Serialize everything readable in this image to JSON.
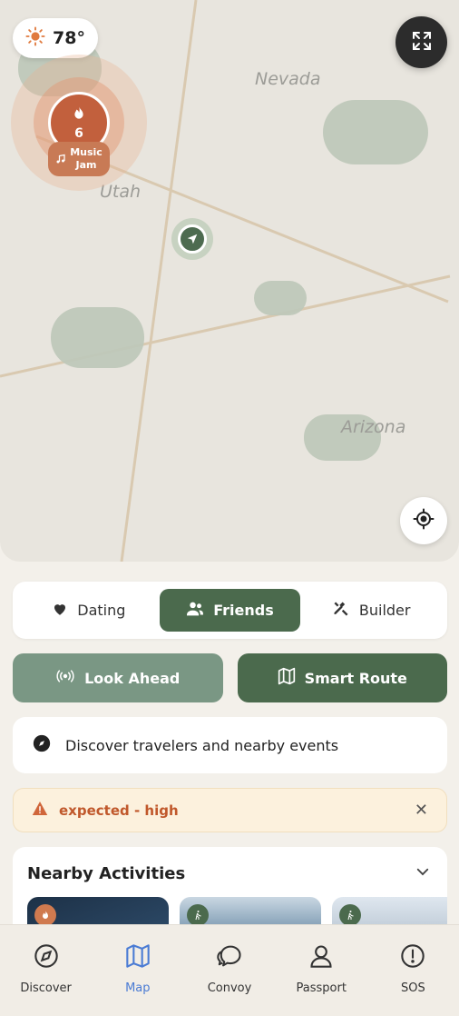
{
  "map": {
    "weather": {
      "icon": "sun-icon",
      "temp": "78°"
    },
    "state_labels": {
      "nevada": "Nevada",
      "utah": "Utah",
      "arizona": "Arizona"
    },
    "event": {
      "icon": "flame-icon",
      "count": "6",
      "tag_icon": "music-note-icon",
      "label_line1": "Music",
      "label_line2": "Jam"
    },
    "colors": {
      "event": "#c2603d",
      "accent": "#4b6a4d"
    }
  },
  "modes": [
    {
      "label": "Dating",
      "icon": "heart-icon",
      "active": false
    },
    {
      "label": "Friends",
      "icon": "users-icon",
      "active": true
    },
    {
      "label": "Builder",
      "icon": "tools-icon",
      "active": false
    }
  ],
  "actions": {
    "look_ahead": "Look Ahead",
    "smart_route": "Smart Route"
  },
  "discover": {
    "text": "Discover travelers and nearby events",
    "icon": "compass-icon"
  },
  "alert": {
    "text": "expected - high",
    "icon": "warning-icon",
    "close": "✕"
  },
  "activities": {
    "title": "Nearby Activities"
  },
  "tabs": [
    {
      "label": "Discover",
      "icon": "compass-icon",
      "active": false
    },
    {
      "label": "Map",
      "icon": "map-icon",
      "active": true
    },
    {
      "label": "Convoy",
      "icon": "chat-icon",
      "active": false
    },
    {
      "label": "Passport",
      "icon": "user-icon",
      "active": false
    },
    {
      "label": "SOS",
      "icon": "alert-circle-icon",
      "active": false
    }
  ]
}
